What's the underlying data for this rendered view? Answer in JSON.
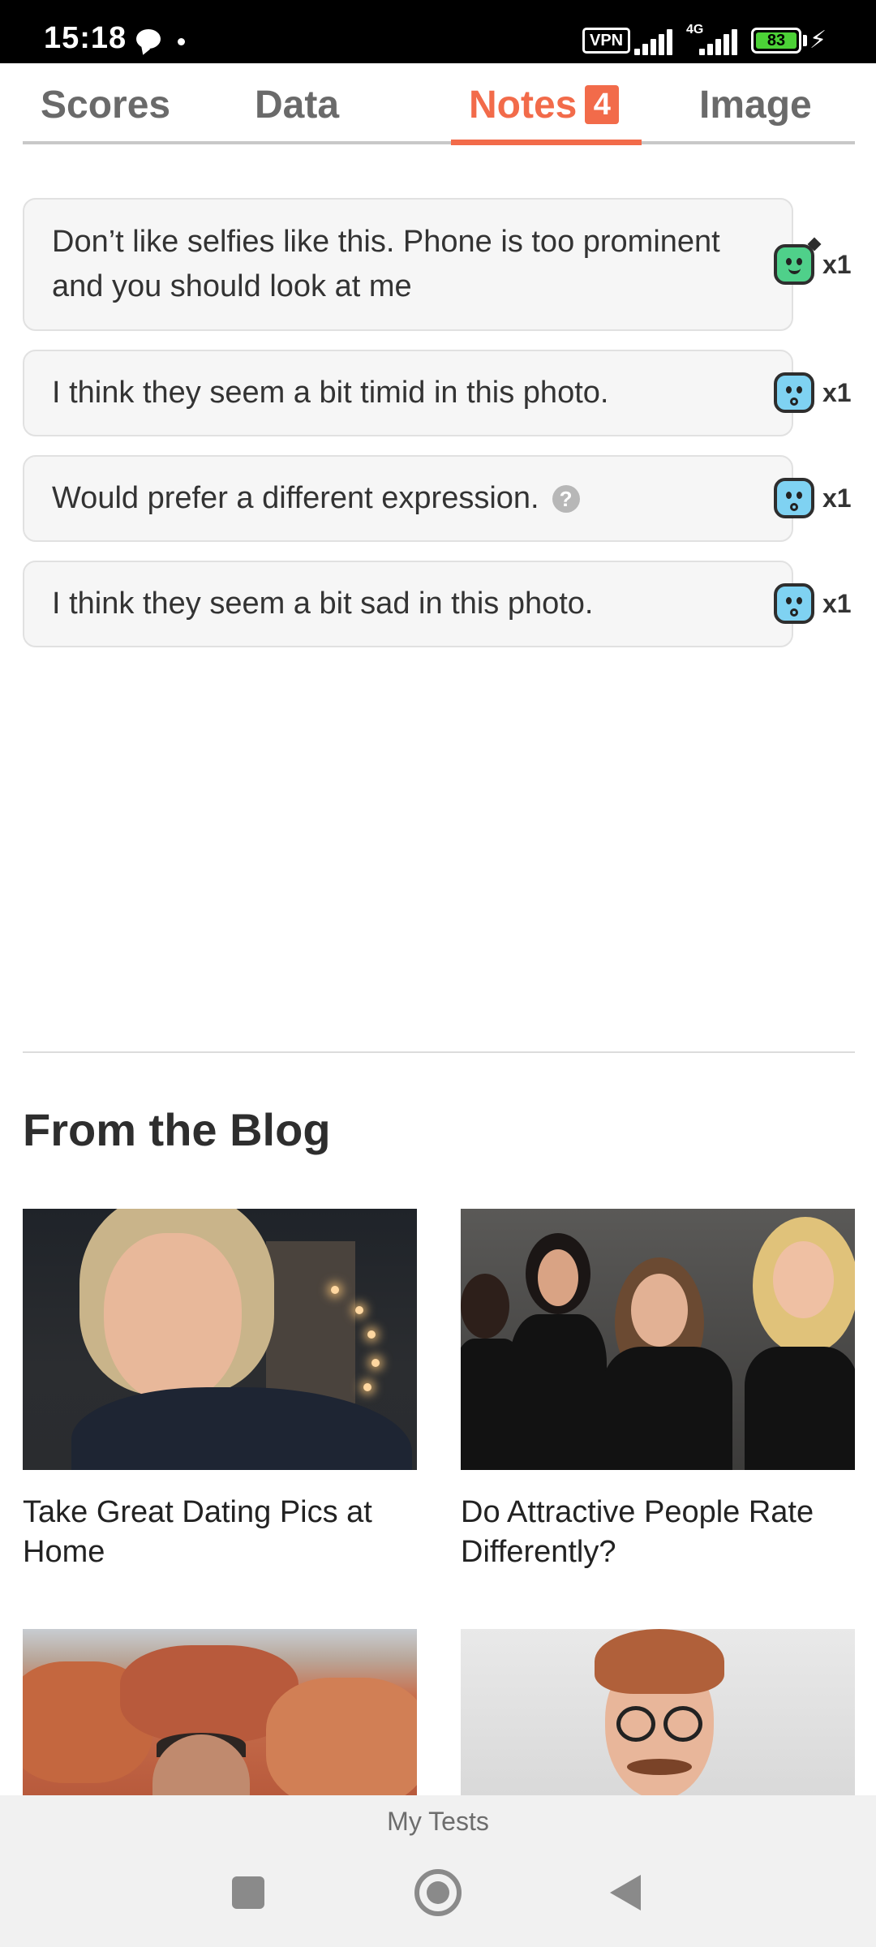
{
  "status_bar": {
    "time": "15:18",
    "vpn": "VPN",
    "network": "4G",
    "battery": "83"
  },
  "tabs": [
    {
      "label": "Scores",
      "active": false
    },
    {
      "label": "Data",
      "active": false
    },
    {
      "label": "Notes",
      "active": true,
      "badge": "4"
    },
    {
      "label": "Image",
      "active": false
    }
  ],
  "notes": [
    {
      "text": "Don’t like selfies like this. Phone is too prominent and you should look at me",
      "reaction_icon": "happy-face-icon",
      "reaction_color": "#4fd08a",
      "count": "x1",
      "help": false
    },
    {
      "text": "I think they seem a bit timid in this photo.",
      "reaction_icon": "surprised-face-icon",
      "reaction_color": "#7fd2f2",
      "count": "x1",
      "help": false
    },
    {
      "text": "Would prefer a different expression.",
      "reaction_icon": "surprised-face-icon",
      "reaction_color": "#7fd2f2",
      "count": "x1",
      "help": true,
      "help_glyph": "?"
    },
    {
      "text": "I think they seem a bit sad in this photo.",
      "reaction_icon": "surprised-face-icon",
      "reaction_color": "#7fd2f2",
      "count": "x1",
      "help": false
    }
  ],
  "blog": {
    "title": "From the Blog",
    "posts": [
      {
        "caption": "Take Great Dating Pics at Home"
      },
      {
        "caption": "Do Attractive People Rate Differently?"
      },
      {
        "caption": ""
      },
      {
        "caption": ""
      }
    ]
  },
  "bottom_nav": {
    "label": "My Tests"
  },
  "colors": {
    "accent": "#f26b4a",
    "note_bg": "#f6f6f6"
  }
}
